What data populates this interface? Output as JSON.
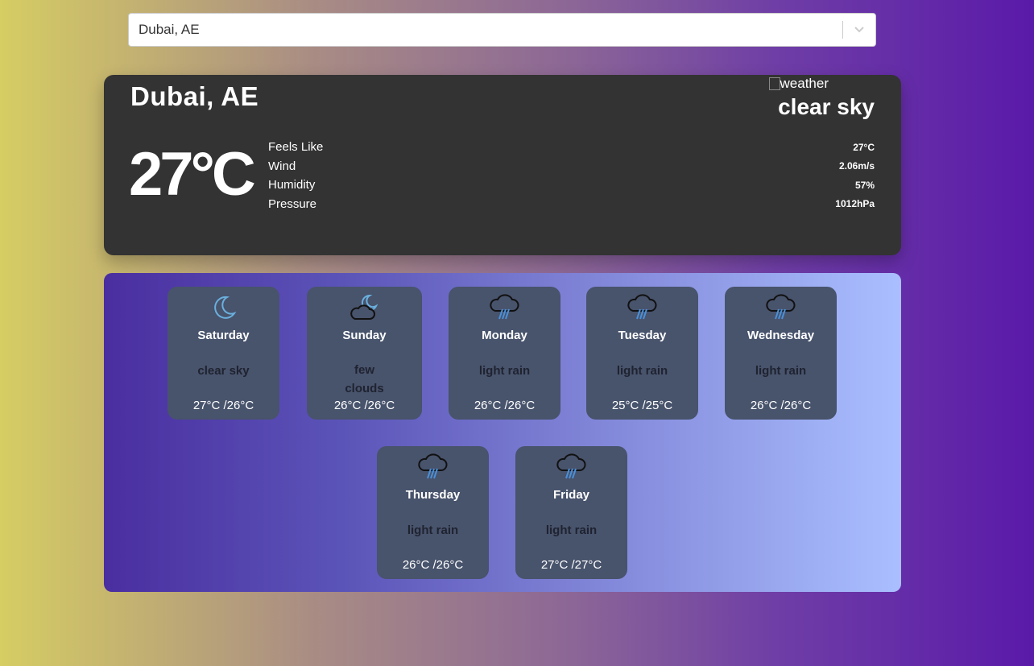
{
  "search": {
    "value": "Dubai, AE"
  },
  "current": {
    "city": "Dubai, AE",
    "image_alt": "weather",
    "description": "clear sky",
    "temperature": "27°C",
    "details": [
      {
        "label": "Feels Like",
        "value": "27°C"
      },
      {
        "label": "Wind",
        "value": "2.06m/s"
      },
      {
        "label": "Humidity",
        "value": "57%"
      },
      {
        "label": "Pressure",
        "value": "1012hPa"
      }
    ]
  },
  "forecast": [
    {
      "day": "Saturday",
      "condition": "clear sky",
      "range": "27°C /26°C",
      "icon": "moon-icon"
    },
    {
      "day": "Sunday",
      "condition": "few clouds",
      "range": "26°C /26°C",
      "icon": "moon-cloud-icon"
    },
    {
      "day": "Monday",
      "condition": "light rain",
      "range": "26°C /26°C",
      "icon": "rain-cloud-icon"
    },
    {
      "day": "Tuesday",
      "condition": "light rain",
      "range": "25°C /25°C",
      "icon": "rain-cloud-icon"
    },
    {
      "day": "Wednesday",
      "condition": "light rain",
      "range": "26°C /26°C",
      "icon": "rain-cloud-icon"
    },
    {
      "day": "Thursday",
      "condition": "light rain",
      "range": "26°C /26°C",
      "icon": "rain-cloud-icon"
    },
    {
      "day": "Friday",
      "condition": "light rain",
      "range": "27°C /27°C",
      "icon": "rain-cloud-icon"
    }
  ]
}
